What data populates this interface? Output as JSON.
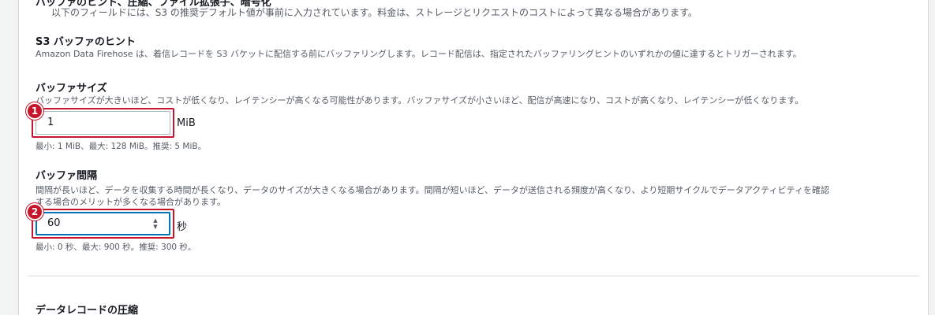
{
  "top": {
    "title": "バッファのヒント、圧縮、ファイル拡張子、暗号化",
    "description": "以下のフィールドには、S3 の推奨デフォルト値が事前に入力されています。料金は、ストレージとリクエストのコストによって異なる場合があります。"
  },
  "buffer_hints": {
    "title": "S3 バッファのヒント",
    "description": "Amazon Data Firehose は、着信レコードを S3 バケットに配信する前にバッファリングします。レコード配信は、指定されたバッファリングヒントのいずれかの値に達するとトリガーされます。"
  },
  "buffer_size": {
    "label": "バッファサイズ",
    "description": "バッファサイズが大きいほど、コストが低くなり、レイテンシーが高くなる可能性があります。バッファサイズが小さいほど、配信が高速になり、コストが高くなり、レイテンシーが低くなります。",
    "value": "1",
    "unit": "MiB",
    "help": "最小: 1 MiB、最大: 128 MiB。推奨: 5 MiB。",
    "marker": "1"
  },
  "buffer_interval": {
    "label": "バッファ間隔",
    "description_line1": "間隔が長いほど、データを収集する時間が長くなり、データのサイズが大きくなる場合があります。間隔が短いほど、データが送信される頻度が高くなり、より短期サイクルでデータアクティビティを確認",
    "description_line2": "する場合のメリットが多くなる場合があります。",
    "value": "60",
    "unit": "秒",
    "help": "最小: 0 秒、最大: 900 秒。推奨: 300 秒。",
    "marker": "2",
    "spinner_up": "▲",
    "spinner_down": "▼"
  },
  "compression": {
    "title": "データレコードの圧縮"
  },
  "colors": {
    "highlight": "#c7162b",
    "focus": "#0073bb"
  }
}
